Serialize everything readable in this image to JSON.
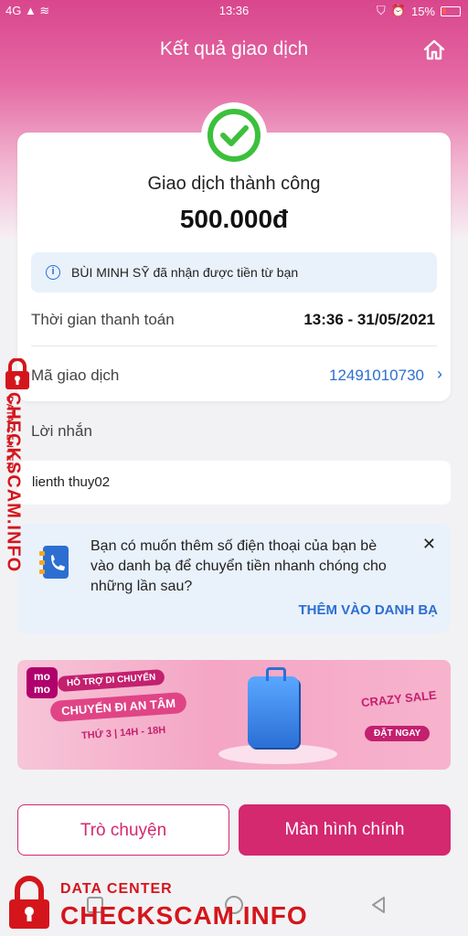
{
  "status_bar": {
    "carrier_icons": "4G ▲ ≋",
    "time": "13:36",
    "battery": "15%"
  },
  "header": {
    "title": "Kết quả giao dịch"
  },
  "result": {
    "status": "Giao dịch thành công",
    "amount": "500.000đ",
    "info": "BÙI MINH SỸ đã nhận được tiền từ bạn"
  },
  "details": {
    "payment_time_label": "Thời gian thanh toán",
    "payment_time_value": "13:36 - 31/05/2021",
    "transaction_id_label": "Mã giao dịch",
    "transaction_id_value": "12491010730"
  },
  "message": {
    "label": "Lời nhắn",
    "value": "lienth thuy02"
  },
  "suggestion": {
    "text": "Bạn có muốn thêm số điện thoại của bạn bè vào danh bạ để chuyển tiền nhanh chóng cho những lần sau?",
    "action": "THÊM VÀO DANH BẠ"
  },
  "banner": {
    "logo": "mo mo",
    "tag": "HỖ TRỢ DI CHUYỂN",
    "headline": "CHUYẾN ĐI AN TÂM",
    "schedule": "THỨ 3 | 14H - 18H",
    "crazy_sale": "CRAZY SALE",
    "cta": "ĐẶT NGAY"
  },
  "buttons": {
    "chat": "Trò chuyện",
    "home": "Màn hình chính"
  },
  "watermark": {
    "small": "DATA CENTER",
    "big": "CHECKSCAM.INFO"
  },
  "colors": {
    "brand": "#d4286f",
    "link": "#2c6fd1",
    "success": "#3cc03c",
    "watermark": "#d4161c"
  }
}
